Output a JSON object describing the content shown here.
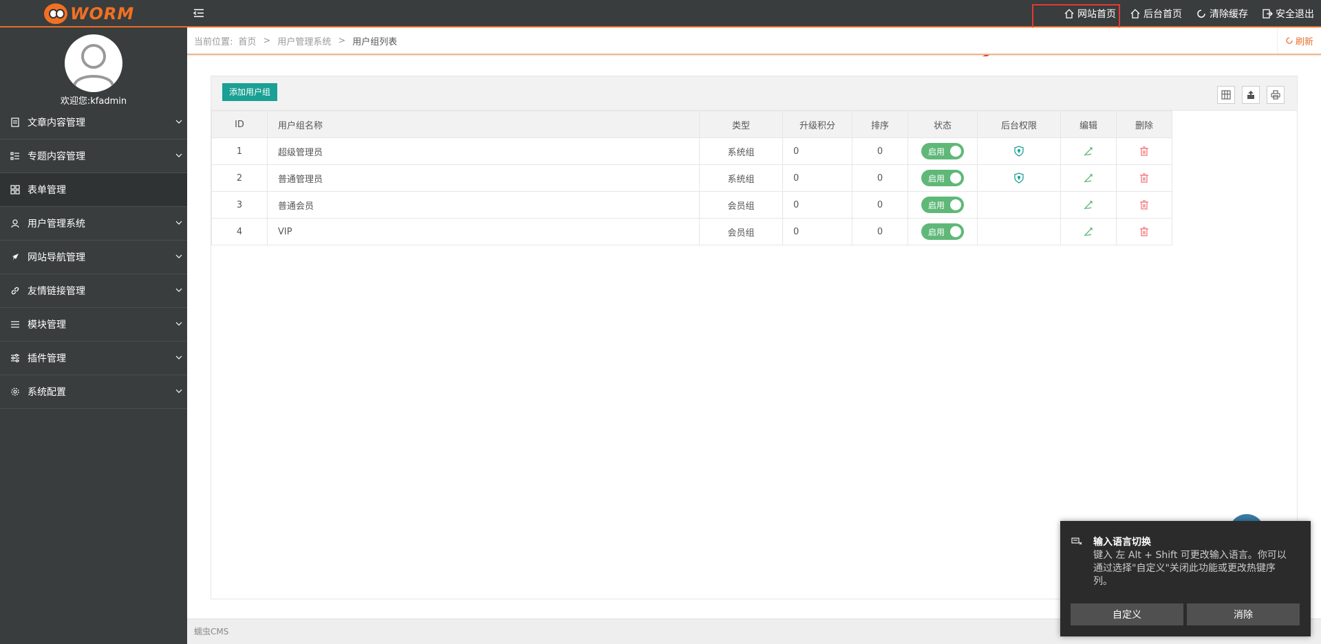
{
  "logo": {
    "text": "WORM"
  },
  "header": {
    "links": [
      {
        "label": "网站首页",
        "icon": "home-icon"
      },
      {
        "label": "后台首页",
        "icon": "home-icon"
      },
      {
        "label": "清除缓存",
        "icon": "refresh-icon"
      },
      {
        "label": "安全退出",
        "icon": "logout-icon"
      }
    ]
  },
  "sidebar": {
    "welcome": "欢迎您:kfadmin",
    "items": [
      {
        "label": "文章内容管理",
        "icon": "document-icon"
      },
      {
        "label": "专题内容管理",
        "icon": "list-icon"
      },
      {
        "label": "表单管理",
        "icon": "grid-icon"
      },
      {
        "label": "用户管理系统",
        "icon": "users-icon"
      },
      {
        "label": "网站导航管理",
        "icon": "compass-icon"
      },
      {
        "label": "友情链接管理",
        "icon": "link-icon"
      },
      {
        "label": "模块管理",
        "icon": "menu-icon"
      },
      {
        "label": "插件管理",
        "icon": "sliders-icon"
      },
      {
        "label": "系统配置",
        "icon": "gear-icon"
      }
    ]
  },
  "breadcrumb": {
    "prefix": "当前位置:",
    "items": [
      "首页",
      "用户管理系统",
      "用户组列表"
    ],
    "refresh": "刷新"
  },
  "toolbar": {
    "add_label": "添加用户组"
  },
  "table": {
    "headers": [
      "ID",
      "用户组名称",
      "类型",
      "升级积分",
      "排序",
      "状态",
      "后台权限",
      "编辑",
      "删除"
    ],
    "rows": [
      {
        "id": "1",
        "name": "超级管理员",
        "type": "系统组",
        "points": "0",
        "sort": "0",
        "status": "启用",
        "admin": true
      },
      {
        "id": "2",
        "name": "普通管理员",
        "type": "系统组",
        "points": "0",
        "sort": "0",
        "status": "启用",
        "admin": true
      },
      {
        "id": "3",
        "name": "普通会员",
        "type": "会员组",
        "points": "0",
        "sort": "0",
        "status": "启用",
        "admin": false
      },
      {
        "id": "4",
        "name": "VIP",
        "type": "会员组",
        "points": "0",
        "sort": "0",
        "status": "启用",
        "admin": false
      }
    ]
  },
  "footer": {
    "text": "蠕虫CMS"
  },
  "toast": {
    "title": "输入语言切换",
    "body": "键入 左 Alt + Shift 可更改输入语言。你可以通过选择\"自定义\"关闭此功能或更改热键序列。",
    "customize": "自定义",
    "dismiss": "消除"
  },
  "colors": {
    "accent": "#e96e2a",
    "primary": "#1aa094",
    "toggle": "#5fb878",
    "danger": "#e53935"
  }
}
